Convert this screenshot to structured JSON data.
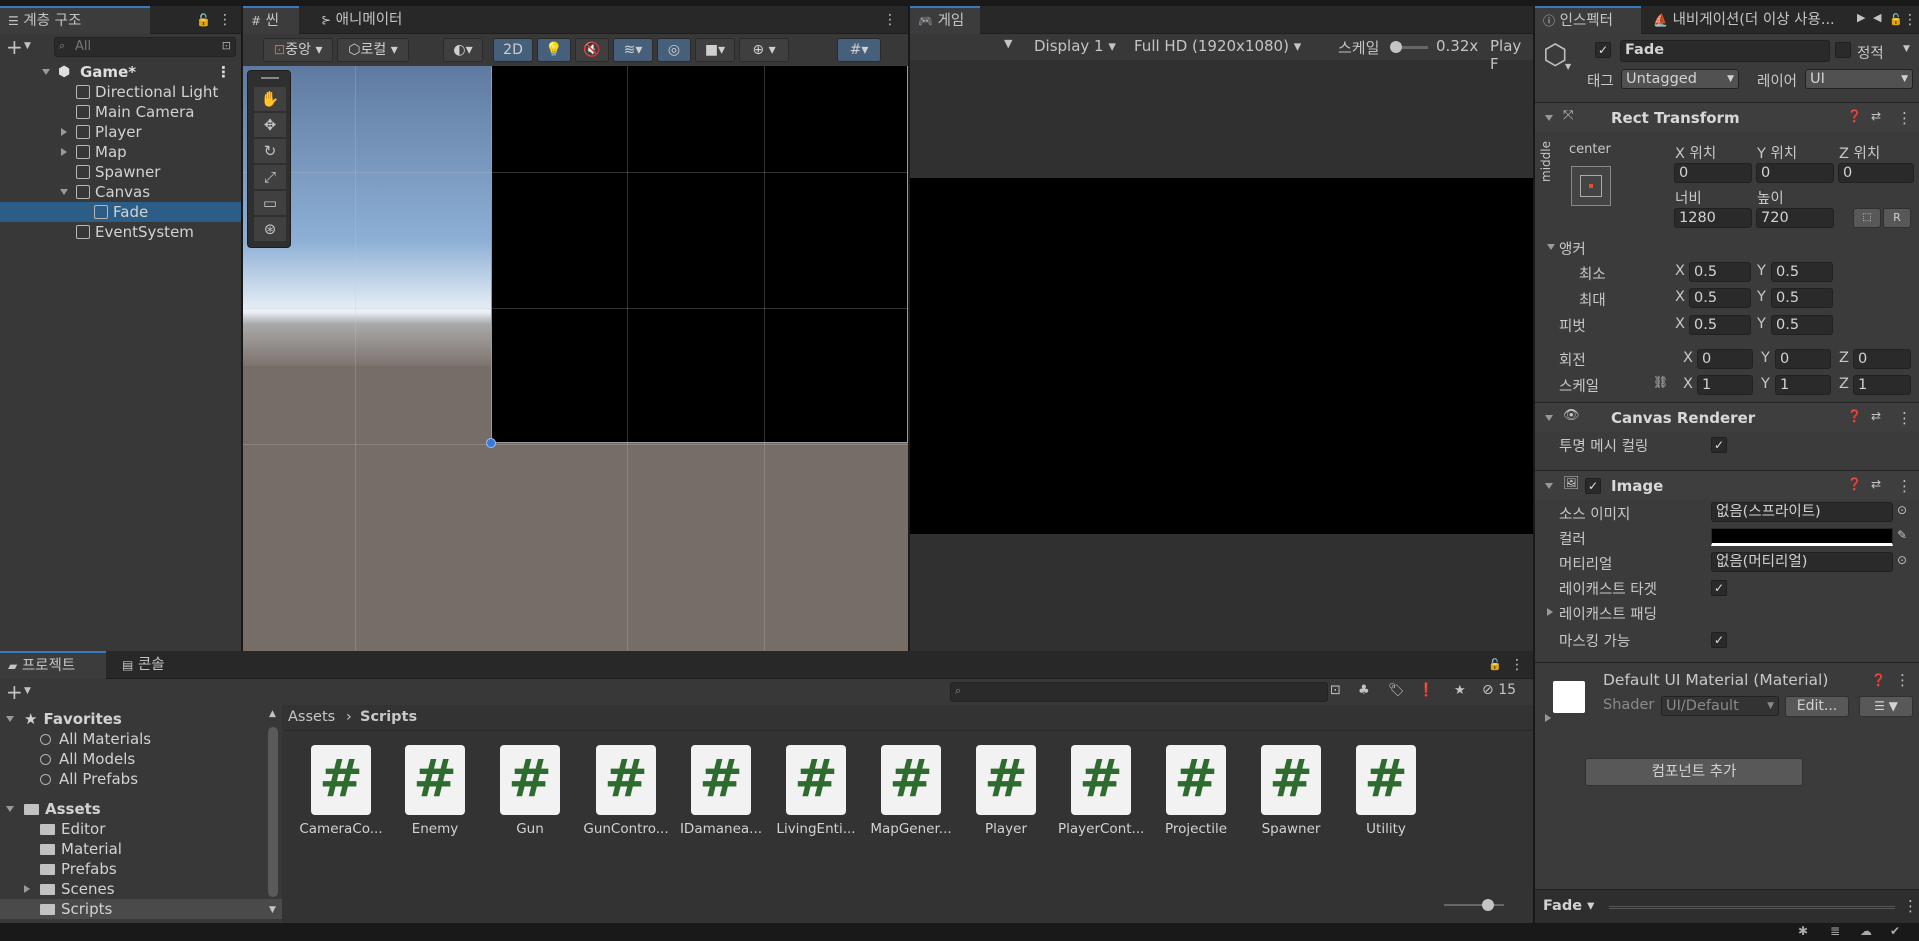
{
  "hierarchy": {
    "tab": "계층 구조",
    "search_placeholder": "All",
    "scene": "Game*",
    "items": [
      {
        "label": "Directional Light"
      },
      {
        "label": "Main Camera"
      },
      {
        "label": "Player"
      },
      {
        "label": "Map"
      },
      {
        "label": "Spawner"
      },
      {
        "label": "Canvas"
      },
      {
        "label": "Fade"
      },
      {
        "label": "EventSystem"
      }
    ]
  },
  "scene_view": {
    "tabs": [
      "씬",
      "애니메이터"
    ],
    "pivot_label": "중앙",
    "space_label": "로컬",
    "mode_2d": "2D"
  },
  "game_view": {
    "tab": "게임",
    "display": "Display 1",
    "resolution": "Full HD (1920x1080)",
    "scale_label": "스케일",
    "scale_value": "0.32x",
    "play_label": "Play F"
  },
  "inspector": {
    "tabs": [
      "인스펙터",
      "내비게이션(더 이상 사용..."
    ],
    "object_name": "Fade",
    "static_label": "정적",
    "tag_label": "태그",
    "tag_value": "Untagged",
    "layer_label": "레이어",
    "layer_value": "UI",
    "rect_transform": {
      "title": "Rect Transform",
      "anchor_preset_top": "center",
      "anchor_preset_side": "middle",
      "pos_x_label": "X 위치",
      "pos_y_label": "Y 위치",
      "pos_z_label": "Z 위치",
      "pos_x": "0",
      "pos_y": "0",
      "pos_z": "0",
      "width_label": "너비",
      "height_label": "높이",
      "width": "1280",
      "height": "720",
      "anchors_label": "앵커",
      "min_label": "최소",
      "max_label": "최대",
      "min_x": "0.5",
      "min_y": "0.5",
      "max_x": "0.5",
      "max_y": "0.5",
      "pivot_label": "피벗",
      "pivot_x": "0.5",
      "pivot_y": "0.5",
      "rotation_label": "회전",
      "rot_x": "0",
      "rot_y": "0",
      "rot_z": "0",
      "scale_label": "스케일",
      "scale_x": "1",
      "scale_y": "1",
      "scale_z": "1"
    },
    "canvas_renderer": {
      "title": "Canvas Renderer",
      "cull_label": "투명 메시 컬링"
    },
    "image": {
      "title": "Image",
      "source_label": "소스 이미지",
      "source_value": "없음(스프라이트)",
      "color_label": "컬러",
      "material_label": "머티리얼",
      "material_value": "없음(머티리얼)",
      "raycast_label": "레이캐스트 타겟",
      "raycast_padding_label": "레이캐스트 패딩",
      "maskable_label": "마스킹 가능"
    },
    "material_block": {
      "title": "Default UI Material (Material)",
      "shader_label": "Shader",
      "shader_value": "UI/Default",
      "edit_label": "Edit..."
    },
    "add_component": "컴포넌트 추가",
    "footer_name": "Fade"
  },
  "project": {
    "tabs": [
      "프로젝트",
      "콘솔"
    ],
    "hidden_count": "15",
    "breadcrumb_root": "Assets",
    "breadcrumb_current": "Scripts",
    "favorites_label": "Favorites",
    "favorites": [
      "All Materials",
      "All Models",
      "All Prefabs"
    ],
    "assets_label": "Assets",
    "folders": [
      "Editor",
      "Material",
      "Prefabs",
      "Scenes",
      "Scripts"
    ],
    "scripts": [
      "CameraCo...",
      "Enemy",
      "Gun",
      "GunContro...",
      "IDamanea...",
      "LivingEnti...",
      "MapGener...",
      "Player",
      "PlayerCont...",
      "Projectile",
      "Spawner",
      "Utility"
    ]
  },
  "colors": {
    "accent": "#3a79bb",
    "selection": "#2c5d87",
    "panel": "#383838",
    "script_icon": "#2e6b2e"
  }
}
